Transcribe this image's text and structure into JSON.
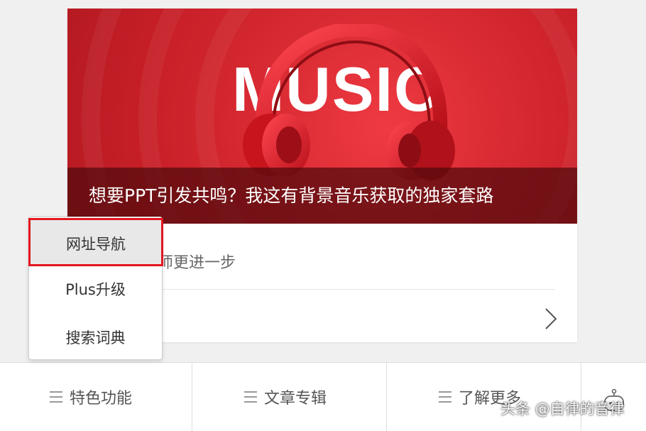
{
  "banner": {
    "big_text": "MUSIC",
    "caption": "想要PPT引发共鸣？我这有背景音乐获取的独家套路"
  },
  "article": {
    "subtitle_partial": "计师更进一步"
  },
  "dropdown": {
    "items": [
      "网址导航",
      "Plus升级",
      "搜索词典"
    ],
    "highlighted": "网址导航"
  },
  "bottom_nav": {
    "items": [
      "特色功能",
      "文章专辑",
      "了解更多"
    ]
  },
  "watermark": "头条 @自律的音律",
  "colors": {
    "accent": "#e3161f",
    "banner": "#d92b33"
  },
  "icons": [
    "headphones-icon",
    "menu-icon",
    "chevron-right-icon",
    "robot-icon"
  ]
}
